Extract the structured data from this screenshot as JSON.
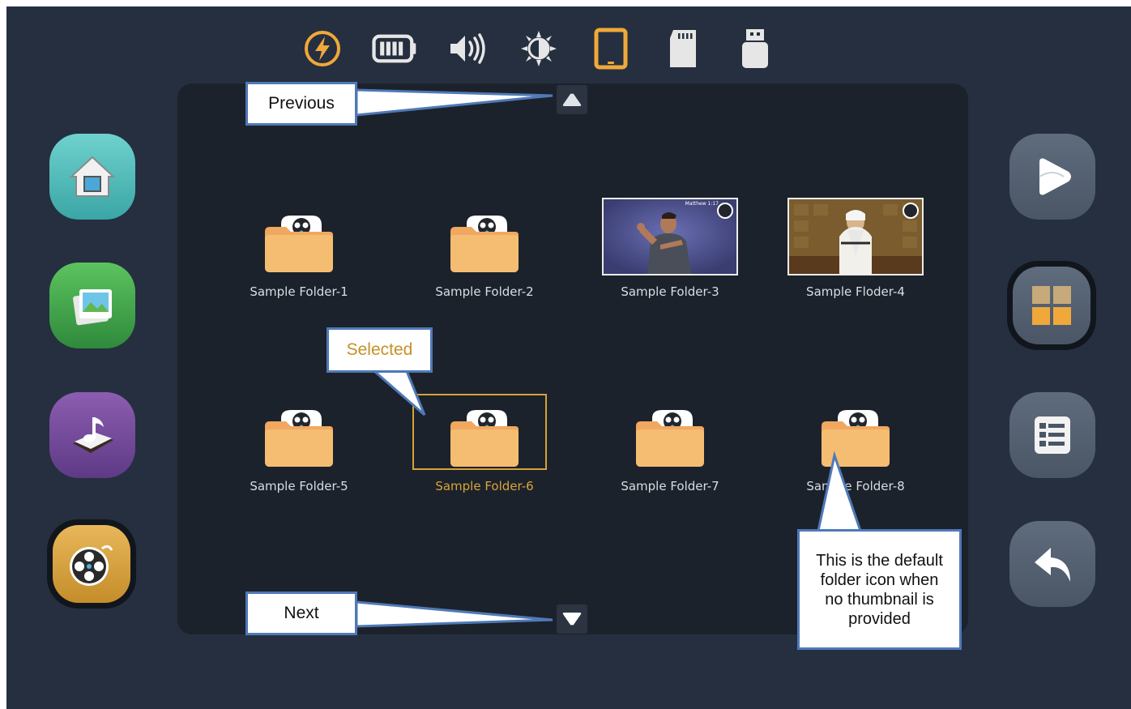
{
  "status_bar": {
    "icons": [
      "charging-icon",
      "battery-icon",
      "volume-icon",
      "brightness-icon",
      "tablet-icon",
      "sd-card-icon",
      "usb-drive-icon"
    ]
  },
  "colors": {
    "background": "#252f3f",
    "panel": "#1c222b",
    "accent": "#f0a83a",
    "selected_text": "#d9a43a",
    "callout_border": "#4f79b8"
  },
  "navigation": {
    "previous_icon": "triangle-up-icon",
    "next_icon": "triangle-down-icon"
  },
  "folders": [
    {
      "label": "Sample Folder-1",
      "thumbnail": "default-folder-icon",
      "selected": false
    },
    {
      "label": "Sample Folder-2",
      "thumbnail": "default-folder-icon",
      "selected": false
    },
    {
      "label": "Sample Folder-3",
      "thumbnail": "video-thumbnail-sign-language",
      "selected": false,
      "thumb_caption": "Matthew 1:17"
    },
    {
      "label": "Sample Floder-4",
      "thumbnail": "video-thumbnail-rabbi",
      "selected": false
    },
    {
      "label": "Sample Folder-5",
      "thumbnail": "default-folder-icon",
      "selected": false
    },
    {
      "label": "Sample Folder-6",
      "thumbnail": "default-folder-icon",
      "selected": true
    },
    {
      "label": "Sample Folder-7",
      "thumbnail": "default-folder-icon",
      "selected": false
    },
    {
      "label": "Sample Folder-8",
      "thumbnail": "default-folder-icon",
      "selected": false
    }
  ],
  "left_nav": [
    "home-icon",
    "photos-icon",
    "music-book-icon",
    "video-reel-icon"
  ],
  "right_nav": [
    "play-icon",
    "grid-view-icon",
    "list-view-icon",
    "back-icon"
  ],
  "callouts": {
    "previous": "Previous",
    "next": "Next",
    "selected": "Selected",
    "default_icon_line1": "This is the default",
    "default_icon_line2": "folder icon when",
    "default_icon_line3": "no thumbnail is",
    "default_icon_line4": "provided"
  }
}
